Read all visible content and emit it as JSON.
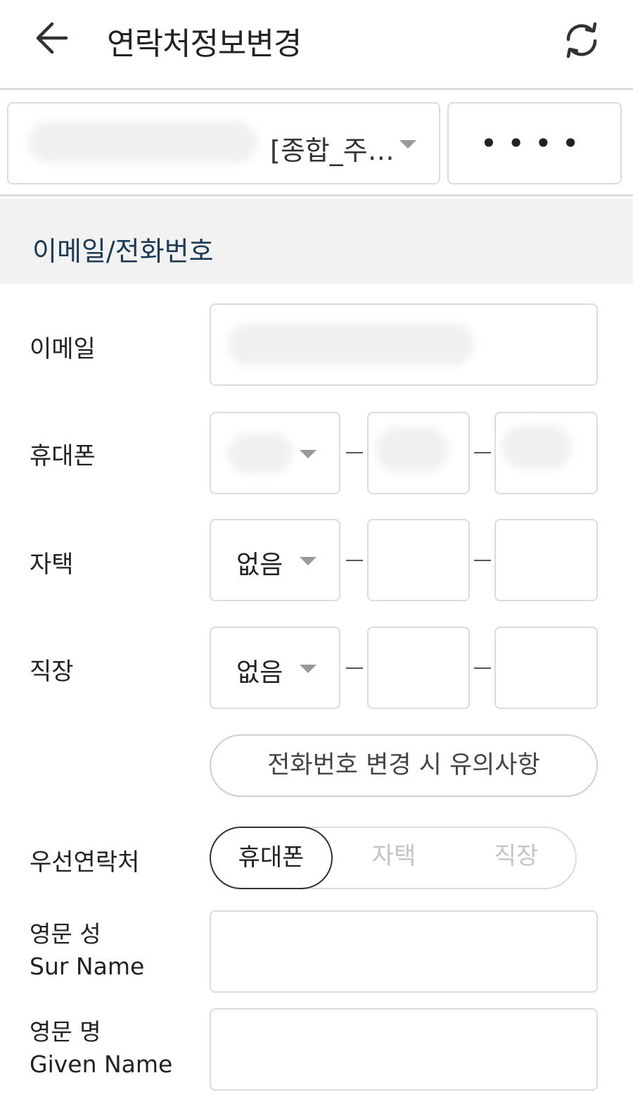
{
  "header": {
    "title": "연락처정보변경",
    "back_icon": "arrow-left-icon",
    "refresh_icon": "refresh-icon"
  },
  "account": {
    "selected_label": "[종합_주…",
    "password_mask": "••••"
  },
  "section": {
    "title": "이메일/전화번호"
  },
  "form": {
    "email_label": "이메일",
    "mobile_label": "휴대폰",
    "home_label": "자택",
    "home_prefix": "없음",
    "work_label": "직장",
    "work_prefix": "없음",
    "notice_button": "전화번호 변경 시 유의사항",
    "preferred_label": "우선연락처",
    "preferred_options": [
      "휴대폰",
      "자택",
      "직장"
    ],
    "surname_label_ko": "영문 성",
    "surname_label_en": "Sur Name",
    "givenname_label_ko": "영문 명",
    "givenname_label_en": "Given Name"
  },
  "colors": {
    "section_bg": "#f2f2f2",
    "section_title": "#1b3a55",
    "border": "#dcdcdc",
    "inactive_text": "#c4c4c4"
  }
}
